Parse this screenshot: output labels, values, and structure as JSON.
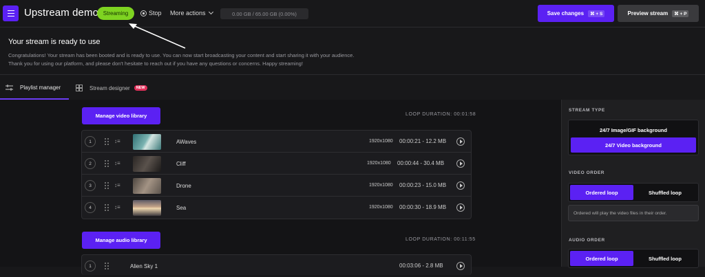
{
  "header": {
    "title": "Upstream demo",
    "status": "Streaming",
    "stop_label": "Stop",
    "more_actions_label": "More actions",
    "storage": "0.00 GB / 65.00 GB (0.00%)",
    "save_label": "Save changes",
    "save_shortcut": "⌘ + S",
    "preview_label": "Preview stream",
    "preview_shortcut": "⌘ + P"
  },
  "banner": {
    "title": "Your stream is ready to use",
    "text": "Congratulations! Your stream has been booted and is ready to use. You can now start broadcasting your content and start sharing it with your audience. Thank you for using our platform, and please don't hesitate to reach out if you have any questions or concerns. Happy streaming!"
  },
  "tabs": [
    {
      "label": "Playlist manager",
      "icon": "sliders-icon",
      "active": true
    },
    {
      "label": "Stream designer",
      "icon": "grid-icon",
      "badge": "NEW"
    }
  ],
  "video_library": {
    "button_label": "Manage video library",
    "loop_duration": "LOOP DURATION: 00:01:58",
    "items": [
      {
        "num": "1",
        "name": "AWaves",
        "resolution": "1920x1080",
        "details": "00:00:21 - 12.2 MB",
        "thumb": "#3f8a86"
      },
      {
        "num": "2",
        "name": "Cliff",
        "resolution": "1920x1080",
        "details": "00:00:44 - 30.4 MB",
        "thumb": "#3a3532"
      },
      {
        "num": "3",
        "name": "Drone",
        "resolution": "1920x1080",
        "details": "00:00:23 - 15.0 MB",
        "thumb": "#7a6f66"
      },
      {
        "num": "4",
        "name": "Sea",
        "resolution": "1920x1080",
        "details": "00:00:30 - 18.9 MB",
        "thumb": "#8a7a66"
      }
    ]
  },
  "audio_library": {
    "button_label": "Manage audio library",
    "loop_duration": "LOOP DURATION: 00:11:55",
    "items": [
      {
        "num": "1",
        "name": "Alien Sky 1",
        "details": "00:03:06 - 2.8 MB"
      }
    ]
  },
  "sidebar": {
    "stream_type_heading": "STREAM TYPE",
    "stream_type_options": [
      "24/7 Image/GIF background",
      "24/7 Video background"
    ],
    "video_order_heading": "VIDEO ORDER",
    "video_order_options": [
      "Ordered loop",
      "Shuffled loop"
    ],
    "video_order_info": "Ordered will play the video files in their order.",
    "audio_order_heading": "AUDIO ORDER",
    "audio_order_options": [
      "Ordered loop",
      "Shuffled loop"
    ]
  }
}
